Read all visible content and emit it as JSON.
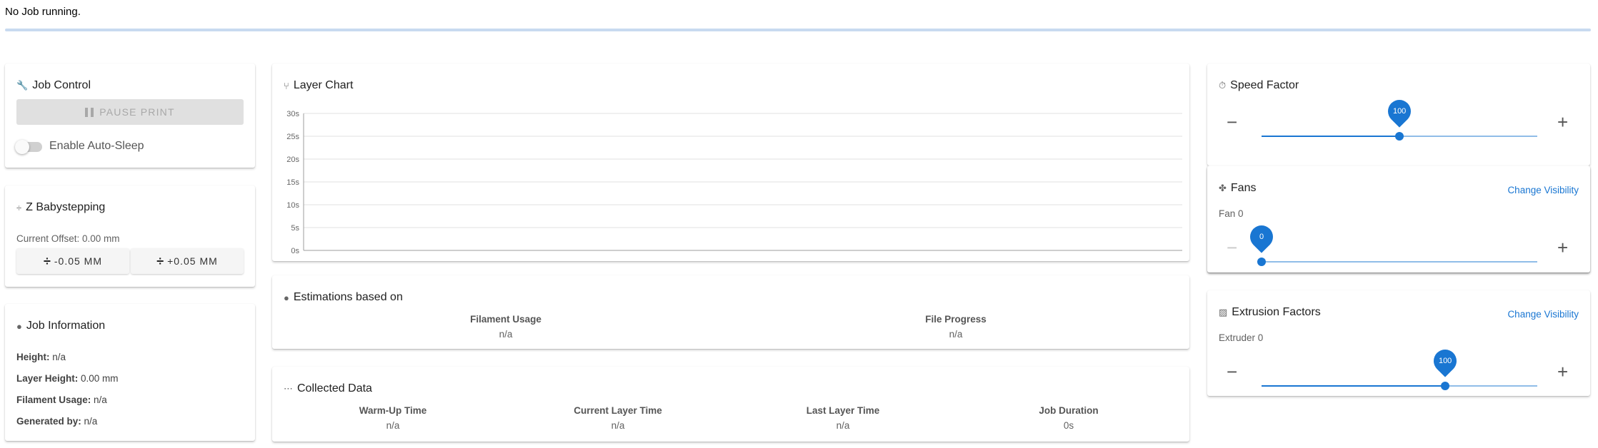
{
  "status": {
    "text": "No Job running."
  },
  "job_control": {
    "title": "Job Control",
    "pause_label": "PAUSE PRINT",
    "auto_sleep_label": "Enable Auto-Sleep",
    "auto_sleep_enabled": false
  },
  "babystepping": {
    "title": "Z Babystepping",
    "offset_text": "Current Offset: 0.00 mm",
    "minus_label": "-0.05 MM",
    "plus_label": "+0.05 MM"
  },
  "job_info": {
    "title": "Job Information",
    "items": [
      {
        "label": "Height:",
        "value": " n/a"
      },
      {
        "label": "Layer Height:",
        "value": " 0.00 mm"
      },
      {
        "label": "Filament Usage:",
        "value": " n/a"
      },
      {
        "label": "Generated by:",
        "value": " n/a"
      }
    ]
  },
  "layer_chart": {
    "title": "Layer Chart"
  },
  "chart_data": {
    "type": "line",
    "title": "Layer Chart",
    "xlabel": "",
    "ylabel": "",
    "ylim": [
      0,
      30
    ],
    "y_ticks": [
      "0s",
      "5s",
      "10s",
      "15s",
      "20s",
      "25s",
      "30s"
    ],
    "series": [],
    "grid": true
  },
  "estimations": {
    "title": "Estimations based on",
    "columns": [
      {
        "label": "Filament Usage",
        "value": "n/a"
      },
      {
        "label": "File Progress",
        "value": "n/a"
      }
    ]
  },
  "collected": {
    "title": "Collected Data",
    "columns": [
      {
        "label": "Warm-Up Time",
        "value": "n/a"
      },
      {
        "label": "Current Layer Time",
        "value": "n/a"
      },
      {
        "label": "Last Layer Time",
        "value": "n/a"
      },
      {
        "label": "Job Duration",
        "value": "0s"
      }
    ]
  },
  "speed_factor": {
    "title": "Speed Factor",
    "value": "100",
    "fraction": 0.5
  },
  "fans": {
    "title": "Fans",
    "change_visibility": "Change Visibility",
    "fan_label": "Fan 0",
    "value": "0",
    "fraction": 0.0
  },
  "extrusion": {
    "title": "Extrusion Factors",
    "change_visibility": "Change Visibility",
    "extruder_label": "Extruder 0",
    "value": "100",
    "fraction": 0.6667
  },
  "colors": {
    "accent": "#1976d2",
    "track": "#90bde8"
  }
}
